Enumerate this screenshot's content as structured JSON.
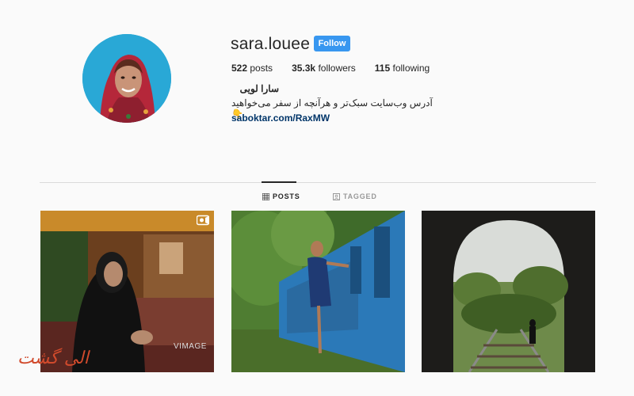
{
  "profile": {
    "username": "sara.louee",
    "follow_label": "Follow",
    "stats": {
      "posts_count": "522",
      "posts_label": "posts",
      "followers_count": "35.3k",
      "followers_label": "followers",
      "following_count": "115",
      "following_label": "following"
    },
    "full_name": "سارا لویی",
    "bio_text": "آدرس وب‌سایت سبک‌تر و هرآنچه از سفر می‌خواهید👇",
    "bio_link": "saboktar.com/RaxMW"
  },
  "tabs": [
    {
      "label": "POSTS",
      "active": true,
      "icon": "grid-icon"
    },
    {
      "label": "TAGGED",
      "active": false,
      "icon": "tag-icon"
    }
  ],
  "posts": [
    {
      "subject": "elderly woman in black hijab sitting indoors",
      "video": true,
      "watermark": "VIMAGE"
    },
    {
      "subject": "woman leaning out of blue train in jungle",
      "video": false
    },
    {
      "subject": "person walking on railway toward tunnel exit",
      "video": false
    }
  ],
  "site_watermark": "الی گشت",
  "colors": {
    "accent": "#3897f0",
    "link": "#003569",
    "avatar_bg": "#29a8d6"
  }
}
